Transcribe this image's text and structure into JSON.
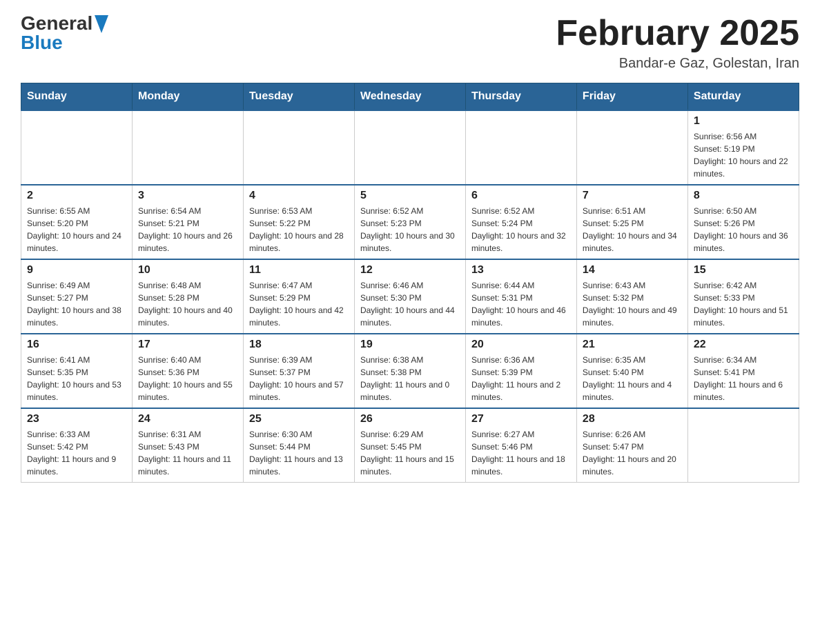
{
  "header": {
    "logo_general": "General",
    "logo_blue": "Blue",
    "title": "February 2025",
    "subtitle": "Bandar-e Gaz, Golestan, Iran"
  },
  "days_of_week": [
    "Sunday",
    "Monday",
    "Tuesday",
    "Wednesday",
    "Thursday",
    "Friday",
    "Saturday"
  ],
  "weeks": [
    [
      {
        "day": "",
        "info": ""
      },
      {
        "day": "",
        "info": ""
      },
      {
        "day": "",
        "info": ""
      },
      {
        "day": "",
        "info": ""
      },
      {
        "day": "",
        "info": ""
      },
      {
        "day": "",
        "info": ""
      },
      {
        "day": "1",
        "info": "Sunrise: 6:56 AM\nSunset: 5:19 PM\nDaylight: 10 hours and 22 minutes."
      }
    ],
    [
      {
        "day": "2",
        "info": "Sunrise: 6:55 AM\nSunset: 5:20 PM\nDaylight: 10 hours and 24 minutes."
      },
      {
        "day": "3",
        "info": "Sunrise: 6:54 AM\nSunset: 5:21 PM\nDaylight: 10 hours and 26 minutes."
      },
      {
        "day": "4",
        "info": "Sunrise: 6:53 AM\nSunset: 5:22 PM\nDaylight: 10 hours and 28 minutes."
      },
      {
        "day": "5",
        "info": "Sunrise: 6:52 AM\nSunset: 5:23 PM\nDaylight: 10 hours and 30 minutes."
      },
      {
        "day": "6",
        "info": "Sunrise: 6:52 AM\nSunset: 5:24 PM\nDaylight: 10 hours and 32 minutes."
      },
      {
        "day": "7",
        "info": "Sunrise: 6:51 AM\nSunset: 5:25 PM\nDaylight: 10 hours and 34 minutes."
      },
      {
        "day": "8",
        "info": "Sunrise: 6:50 AM\nSunset: 5:26 PM\nDaylight: 10 hours and 36 minutes."
      }
    ],
    [
      {
        "day": "9",
        "info": "Sunrise: 6:49 AM\nSunset: 5:27 PM\nDaylight: 10 hours and 38 minutes."
      },
      {
        "day": "10",
        "info": "Sunrise: 6:48 AM\nSunset: 5:28 PM\nDaylight: 10 hours and 40 minutes."
      },
      {
        "day": "11",
        "info": "Sunrise: 6:47 AM\nSunset: 5:29 PM\nDaylight: 10 hours and 42 minutes."
      },
      {
        "day": "12",
        "info": "Sunrise: 6:46 AM\nSunset: 5:30 PM\nDaylight: 10 hours and 44 minutes."
      },
      {
        "day": "13",
        "info": "Sunrise: 6:44 AM\nSunset: 5:31 PM\nDaylight: 10 hours and 46 minutes."
      },
      {
        "day": "14",
        "info": "Sunrise: 6:43 AM\nSunset: 5:32 PM\nDaylight: 10 hours and 49 minutes."
      },
      {
        "day": "15",
        "info": "Sunrise: 6:42 AM\nSunset: 5:33 PM\nDaylight: 10 hours and 51 minutes."
      }
    ],
    [
      {
        "day": "16",
        "info": "Sunrise: 6:41 AM\nSunset: 5:35 PM\nDaylight: 10 hours and 53 minutes."
      },
      {
        "day": "17",
        "info": "Sunrise: 6:40 AM\nSunset: 5:36 PM\nDaylight: 10 hours and 55 minutes."
      },
      {
        "day": "18",
        "info": "Sunrise: 6:39 AM\nSunset: 5:37 PM\nDaylight: 10 hours and 57 minutes."
      },
      {
        "day": "19",
        "info": "Sunrise: 6:38 AM\nSunset: 5:38 PM\nDaylight: 11 hours and 0 minutes."
      },
      {
        "day": "20",
        "info": "Sunrise: 6:36 AM\nSunset: 5:39 PM\nDaylight: 11 hours and 2 minutes."
      },
      {
        "day": "21",
        "info": "Sunrise: 6:35 AM\nSunset: 5:40 PM\nDaylight: 11 hours and 4 minutes."
      },
      {
        "day": "22",
        "info": "Sunrise: 6:34 AM\nSunset: 5:41 PM\nDaylight: 11 hours and 6 minutes."
      }
    ],
    [
      {
        "day": "23",
        "info": "Sunrise: 6:33 AM\nSunset: 5:42 PM\nDaylight: 11 hours and 9 minutes."
      },
      {
        "day": "24",
        "info": "Sunrise: 6:31 AM\nSunset: 5:43 PM\nDaylight: 11 hours and 11 minutes."
      },
      {
        "day": "25",
        "info": "Sunrise: 6:30 AM\nSunset: 5:44 PM\nDaylight: 11 hours and 13 minutes."
      },
      {
        "day": "26",
        "info": "Sunrise: 6:29 AM\nSunset: 5:45 PM\nDaylight: 11 hours and 15 minutes."
      },
      {
        "day": "27",
        "info": "Sunrise: 6:27 AM\nSunset: 5:46 PM\nDaylight: 11 hours and 18 minutes."
      },
      {
        "day": "28",
        "info": "Sunrise: 6:26 AM\nSunset: 5:47 PM\nDaylight: 11 hours and 20 minutes."
      },
      {
        "day": "",
        "info": ""
      }
    ]
  ]
}
